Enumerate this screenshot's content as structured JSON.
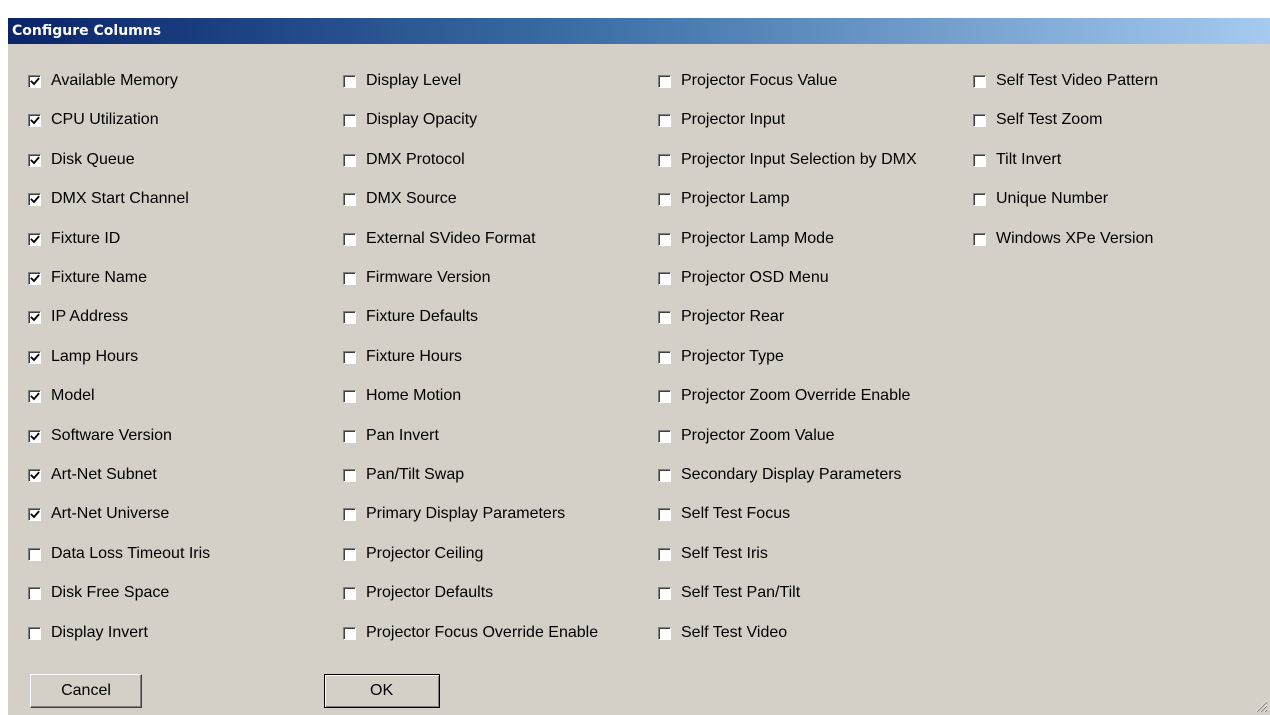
{
  "dialog": {
    "title": "Configure Columns"
  },
  "columns": [
    [
      {
        "label": "Available Memory",
        "checked": true
      },
      {
        "label": "CPU Utilization",
        "checked": true
      },
      {
        "label": "Disk Queue",
        "checked": true
      },
      {
        "label": "DMX Start Channel",
        "checked": true
      },
      {
        "label": "Fixture ID",
        "checked": true
      },
      {
        "label": "Fixture Name",
        "checked": true
      },
      {
        "label": "IP Address",
        "checked": true
      },
      {
        "label": "Lamp Hours",
        "checked": true
      },
      {
        "label": "Model",
        "checked": true
      },
      {
        "label": "Software Version",
        "checked": true
      },
      {
        "label": "Art-Net Subnet",
        "checked": true
      },
      {
        "label": "Art-Net Universe",
        "checked": true
      },
      {
        "label": "Data Loss Timeout Iris",
        "checked": false
      },
      {
        "label": "Disk Free Space",
        "checked": false
      },
      {
        "label": "Display Invert",
        "checked": false
      }
    ],
    [
      {
        "label": "Display Level",
        "checked": false
      },
      {
        "label": "Display Opacity",
        "checked": false
      },
      {
        "label": "DMX Protocol",
        "checked": false
      },
      {
        "label": "DMX Source",
        "checked": false
      },
      {
        "label": "External SVideo Format",
        "checked": false
      },
      {
        "label": "Firmware Version",
        "checked": false
      },
      {
        "label": "Fixture Defaults",
        "checked": false
      },
      {
        "label": "Fixture Hours",
        "checked": false
      },
      {
        "label": "Home Motion",
        "checked": false
      },
      {
        "label": "Pan Invert",
        "checked": false
      },
      {
        "label": "Pan/Tilt Swap",
        "checked": false
      },
      {
        "label": "Primary Display Parameters",
        "checked": false
      },
      {
        "label": "Projector Ceiling",
        "checked": false
      },
      {
        "label": "Projector Defaults",
        "checked": false
      },
      {
        "label": "Projector Focus Override Enable",
        "checked": false
      }
    ],
    [
      {
        "label": "Projector Focus Value",
        "checked": false
      },
      {
        "label": "Projector Input",
        "checked": false
      },
      {
        "label": "Projector Input Selection by DMX",
        "checked": false
      },
      {
        "label": "Projector Lamp",
        "checked": false
      },
      {
        "label": "Projector Lamp Mode",
        "checked": false
      },
      {
        "label": "Projector OSD Menu",
        "checked": false
      },
      {
        "label": "Projector Rear",
        "checked": false
      },
      {
        "label": "Projector Type",
        "checked": false
      },
      {
        "label": "Projector Zoom Override Enable",
        "checked": false
      },
      {
        "label": "Projector Zoom Value",
        "checked": false
      },
      {
        "label": "Secondary Display Parameters",
        "checked": false
      },
      {
        "label": "Self Test Focus",
        "checked": false
      },
      {
        "label": "Self Test Iris",
        "checked": false
      },
      {
        "label": "Self Test Pan/Tilt",
        "checked": false
      },
      {
        "label": "Self Test Video",
        "checked": false
      }
    ],
    [
      {
        "label": "Self Test Video Pattern",
        "checked": false
      },
      {
        "label": "Self Test Zoom",
        "checked": false
      },
      {
        "label": "Tilt Invert",
        "checked": false
      },
      {
        "label": "Unique Number",
        "checked": false
      },
      {
        "label": "Windows XPe Version",
        "checked": false
      }
    ]
  ],
  "buttons": {
    "cancel_label": "Cancel",
    "ok_label": "OK"
  },
  "colors": {
    "titlebar_start": "#0a246a",
    "titlebar_end": "#a6caf0",
    "dialog_face": "#d4d0c8"
  },
  "icons": {
    "checkmark": "checkmark-icon",
    "resize_grip": "resize-grip-icon"
  }
}
